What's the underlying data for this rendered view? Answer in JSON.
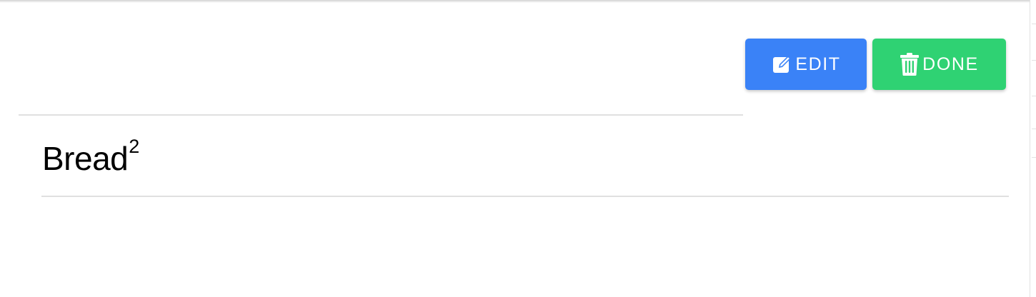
{
  "toolbar": {
    "edit_label": "EDIT",
    "done_label": "DONE",
    "edit_icon": "edit-square-icon",
    "done_icon": "trash-icon"
  },
  "item": {
    "name": "Bread",
    "quantity": "2"
  },
  "colors": {
    "edit_button": "#3a82f7",
    "done_button": "#2fd273",
    "divider": "#e0e0e0",
    "text": "#000000"
  }
}
